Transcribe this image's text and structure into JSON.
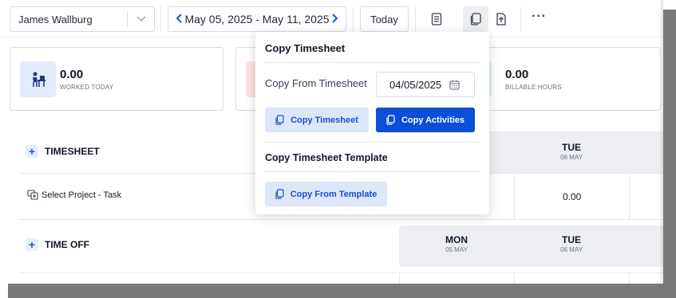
{
  "toolbar": {
    "user_name": "James Wallburg",
    "date_range": "May 05, 2025 - May 11, 2025",
    "today_label": "Today",
    "more_label": "···"
  },
  "cards": [
    {
      "value": "0.00",
      "caption": "WORKED TODAY",
      "icon": "worker-at-desk-icon"
    },
    {
      "value": "",
      "caption": "",
      "icon": ""
    },
    {
      "value": "0.00",
      "caption": "BILLABLE HOURS",
      "icon": ""
    }
  ],
  "timesheet": {
    "section_label": "TIMESHEET",
    "task_label": "Select Project - Task",
    "days": [
      {
        "day": "TUE",
        "date": "06 MAY"
      }
    ],
    "values": [
      "0.00"
    ]
  },
  "time_off": {
    "section_label": "TIME OFF",
    "days": [
      {
        "day": "MON",
        "date": "05 MAY"
      },
      {
        "day": "TUE",
        "date": "06 MAY"
      }
    ]
  },
  "popover": {
    "title": "Copy Timesheet",
    "copy_from_label": "Copy From Timesheet",
    "copy_from_date": "04/05/2025",
    "copy_timesheet_btn": "Copy Timesheet",
    "copy_activities_btn": "Copy Activities",
    "template_title": "Copy Timesheet Template",
    "copy_template_btn": "Copy From Template"
  },
  "colors": {
    "accent": "#0b4fd8",
    "accent_light": "#dce7f8",
    "card_icon_bg": "#e3ecfa",
    "card_icon_bg_red": "#fde2e2",
    "card_icon_bg_green": "#dff3ef",
    "header_bg": "#eceef1"
  }
}
